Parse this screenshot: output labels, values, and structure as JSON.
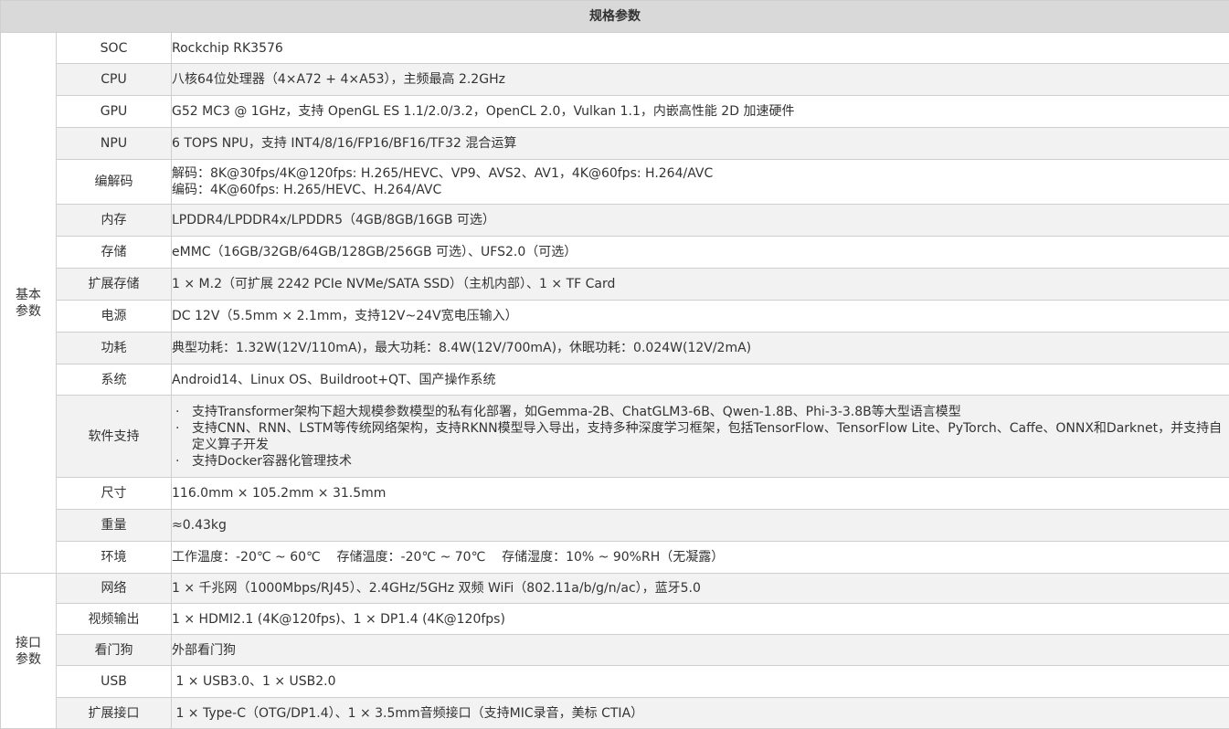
{
  "table": {
    "title": "规格参数",
    "groups": [
      {
        "name": "基本参数",
        "rows": [
          {
            "label": "SOC",
            "lines": [
              "Rockchip RK3576"
            ]
          },
          {
            "label": "CPU",
            "lines": [
              "八核64位处理器（4×A72 + 4×A53），主频最高 2.2GHz"
            ]
          },
          {
            "label": "GPU",
            "lines": [
              "G52 MC3 @ 1GHz，支持 OpenGL ES 1.1/2.0/3.2，OpenCL 2.0，Vulkan 1.1，内嵌高性能 2D 加速硬件"
            ]
          },
          {
            "label": "NPU",
            "lines": [
              "6 TOPS NPU，支持 INT4/8/16/FP16/BF16/TF32 混合运算"
            ]
          },
          {
            "label": "编解码",
            "lines": [
              "解码：8K@30fps/4K@120fps: H.265/HEVC、VP9、AVS2、AV1，4K@60fps: H.264/AVC",
              "编码：4K@60fps: H.265/HEVC、H.264/AVC"
            ]
          },
          {
            "label": "内存",
            "lines": [
              "LPDDR4/LPDDR4x/LPDDR5（4GB/8GB/16GB 可选）"
            ]
          },
          {
            "label": "存储",
            "lines": [
              "eMMC（16GB/32GB/64GB/128GB/256GB 可选）、UFS2.0（可选）"
            ]
          },
          {
            "label": "扩展存储",
            "lines": [
              "1 × M.2（可扩展 2242 PCIe NVMe/SATA SSD）（主机内部）、1 × TF Card"
            ]
          },
          {
            "label": "电源",
            "lines": [
              "DC 12V（5.5mm × 2.1mm，支持12V~24V宽电压输入）"
            ]
          },
          {
            "label": "功耗",
            "lines": [
              "典型功耗：1.32W(12V/110mA)，最大功耗：8.4W(12V/700mA)，休眠功耗：0.024W(12V/2mA)"
            ]
          },
          {
            "label": "系统",
            "lines": [
              "Android14、Linux OS、Buildroot+QT、国产操作系统"
            ]
          },
          {
            "label": "软件支持",
            "bullet": "·",
            "bullets": [
              "支持Transformer架构下超大规模参数模型的私有化部署，如Gemma-2B、ChatGLM3-6B、Qwen-1.8B、Phi-3-3.8B等大型语言模型",
              "支持CNN、RNN、LSTM等传统网络架构，支持RKNN模型导入导出，支持多种深度学习框架，包括TensorFlow、TensorFlow Lite、PyTorch、Caffe、ONNX和Darknet，并支持自定义算子开发",
              "支持Docker容器化管理技术"
            ]
          },
          {
            "label": "尺寸",
            "lines": [
              "116.0mm × 105.2mm × 31.5mm"
            ]
          },
          {
            "label": "重量",
            "lines": [
              "≈0.43kg"
            ]
          },
          {
            "label": "环境",
            "lines": [
              "工作温度：-20℃ ~ 60℃    存储温度：-20℃ ~ 70℃    存储湿度：10% ~ 90%RH（无凝露）"
            ]
          }
        ]
      },
      {
        "name": "接口参数",
        "rows": [
          {
            "label": "网络",
            "lines": [
              "1 × 千兆网（1000Mbps/RJ45）、2.4GHz/5GHz 双频 WiFi（802.11a/b/g/n/ac），蓝牙5.0"
            ]
          },
          {
            "label": "视频输出",
            "lines": [
              "1 × HDMI2.1 (4K@120fps)、1 × DP1.4 (4K@120fps)"
            ]
          },
          {
            "label": "看门狗",
            "lines": [
              "外部看门狗"
            ]
          },
          {
            "label": "USB",
            "lines": [
              " 1 × USB3.0、1 × USB2.0"
            ]
          },
          {
            "label": "扩展接口",
            "lines": [
              " 1 × Type-C（OTG/DP1.4）、1 × 3.5mm音频接口（支持MIC录音，美标 CTIA）"
            ]
          }
        ]
      }
    ]
  }
}
